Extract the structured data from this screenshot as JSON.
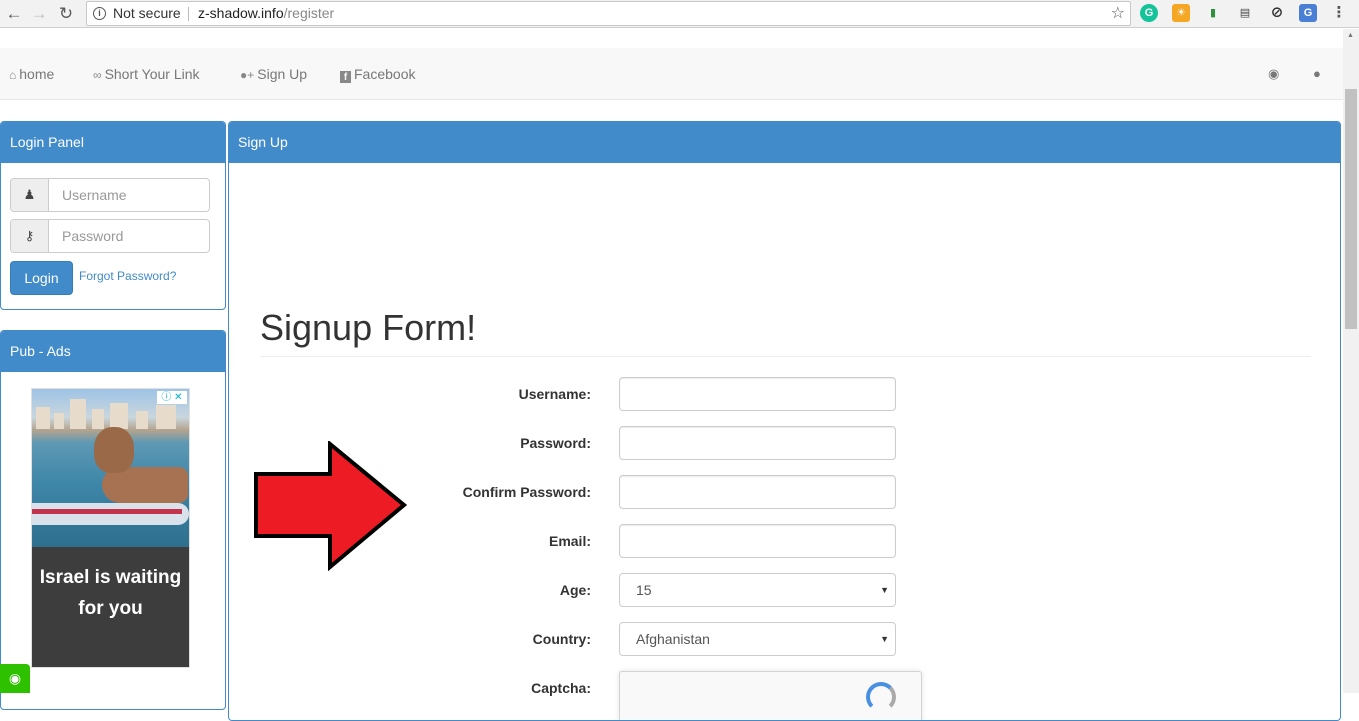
{
  "browser": {
    "security_text": "Not secure",
    "url_host": "z-shadow.info",
    "url_path": "/register"
  },
  "navbar": {
    "links": [
      {
        "label": "home",
        "icon": "home-icon"
      },
      {
        "label": "Short Your Link",
        "icon": "link-icon"
      },
      {
        "label": "Sign Up",
        "icon": "user-plus-icon"
      },
      {
        "label": "Facebook",
        "icon": "facebook-icon"
      }
    ],
    "right_icons": [
      "globe-icon",
      "tint-icon"
    ]
  },
  "login_panel": {
    "title": "Login Panel",
    "username_placeholder": "Username",
    "password_placeholder": "Password",
    "login_button": "Login",
    "forgot_link": "Forgot Password?"
  },
  "ads_panel": {
    "title": "Pub - Ads",
    "ad_text": "Israel is waiting for you"
  },
  "signup_panel": {
    "title": "Sign Up",
    "form_title": "Signup Form!",
    "fields": {
      "username": "Username:",
      "password": "Password:",
      "confirm_password": "Confirm Password:",
      "email": "Email:",
      "age": "Age:",
      "country": "Country:",
      "captcha": "Captcha:"
    },
    "age_value": "15",
    "country_value": "Afghanistan"
  },
  "colors": {
    "primary": "#428bca",
    "arrow_red": "#ed1c24"
  }
}
